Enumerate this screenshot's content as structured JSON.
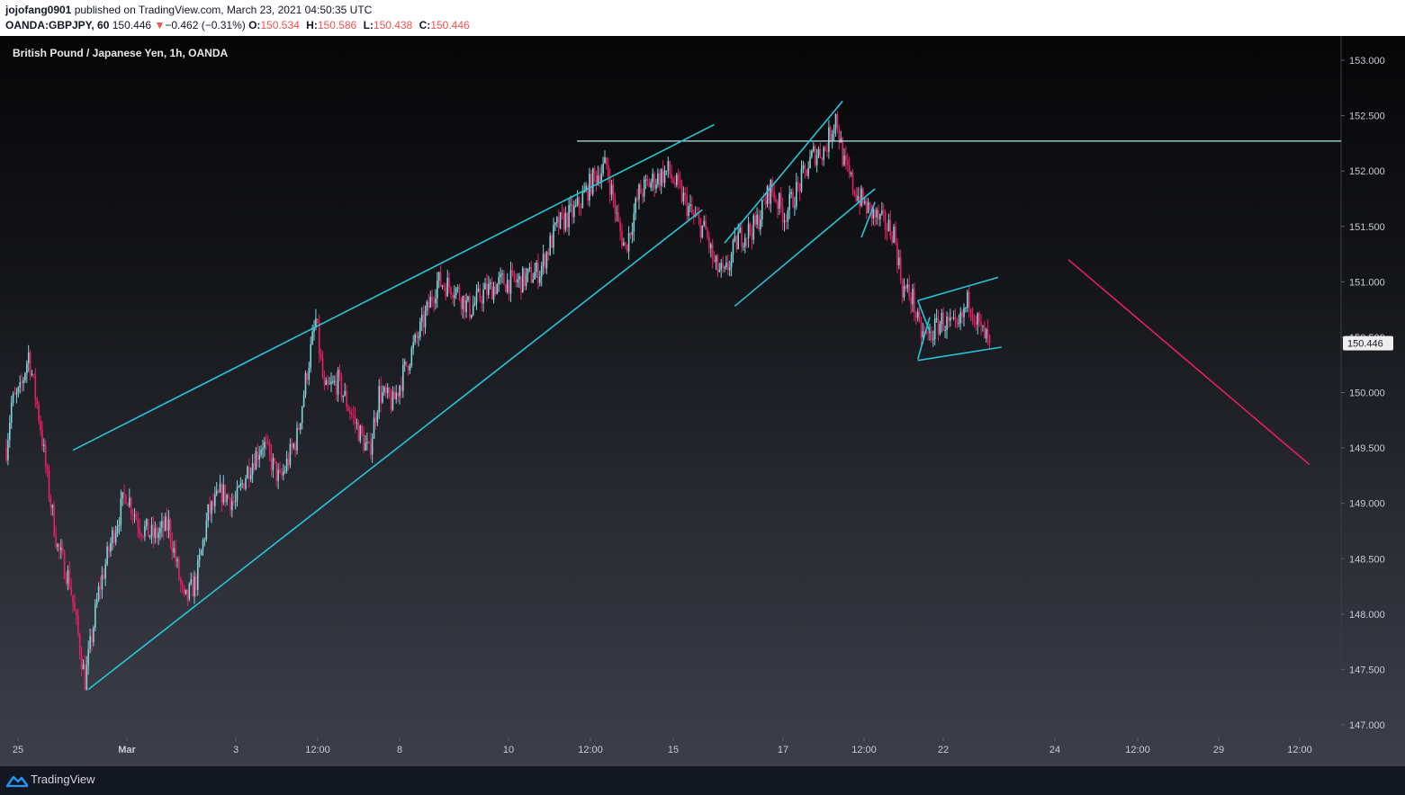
{
  "header": {
    "user": "jojofang0901",
    "published_text": " published on TradingView.com, March 23, 2021 04:50:35 UTC",
    "symbol": "OANDA:GBPJPY, 60",
    "price": "150.446",
    "change_arrow": "▼",
    "change": "−0.462 (−0.31%)",
    "o_label": "O:",
    "o_value": "150.534",
    "h_label": "H:",
    "h_value": "150.586",
    "l_label": "L:",
    "l_value": "150.438",
    "c_label": "C:",
    "c_value": "150.446"
  },
  "chart_title": "British Pound / Japanese Yen, 1h, OANDA",
  "footer": {
    "brand": "TradingView"
  },
  "colors": {
    "bull": "#81d4da",
    "bear": "#e91e63",
    "trendline": "#26c6da",
    "resistance": "#b2ebf2",
    "projection": "#e91e63",
    "axis_text": "#c8cbd4",
    "price_label_bg": "#eeeeee"
  },
  "chart_data": {
    "type": "candlestick",
    "interval": "1h",
    "ylim": [
      146.88,
      153.2
    ],
    "y_ticks": [
      "147.000",
      "147.500",
      "148.000",
      "148.500",
      "149.000",
      "149.500",
      "150.000",
      "150.500",
      "151.000",
      "151.500",
      "152.000",
      "152.500",
      "153.000"
    ],
    "x_ticks": [
      "25",
      "Mar",
      "3",
      "12:00",
      "8",
      "10",
      "12:00",
      "15",
      "17",
      "12:00",
      "22",
      "24",
      "12:00",
      "29",
      "12:00"
    ],
    "last_price_label": "150.446",
    "last_price": 150.446,
    "horizontal_level": 152.27,
    "anchors": [
      {
        "t": 0,
        "v": 149.5
      },
      {
        "t": 3,
        "v": 149.9
      },
      {
        "t": 8,
        "v": 150.0
      },
      {
        "t": 13,
        "v": 150.35
      },
      {
        "t": 20,
        "v": 149.7
      },
      {
        "t": 24,
        "v": 149.2
      },
      {
        "t": 30,
        "v": 148.6
      },
      {
        "t": 37,
        "v": 148.3
      },
      {
        "t": 46,
        "v": 147.4
      },
      {
        "t": 54,
        "v": 148.2
      },
      {
        "t": 62,
        "v": 148.7
      },
      {
        "t": 70,
        "v": 149.1
      },
      {
        "t": 78,
        "v": 148.8
      },
      {
        "t": 86,
        "v": 148.7
      },
      {
        "t": 95,
        "v": 148.8
      },
      {
        "t": 104,
        "v": 148.1
      },
      {
        "t": 111,
        "v": 148.3
      },
      {
        "t": 118,
        "v": 148.9
      },
      {
        "t": 126,
        "v": 149.1
      },
      {
        "t": 134,
        "v": 149.0
      },
      {
        "t": 141,
        "v": 149.3
      },
      {
        "t": 150,
        "v": 149.55
      },
      {
        "t": 160,
        "v": 149.2
      },
      {
        "t": 170,
        "v": 149.6
      },
      {
        "t": 176,
        "v": 150.2
      },
      {
        "t": 181,
        "v": 150.65
      },
      {
        "t": 186,
        "v": 150.0
      },
      {
        "t": 194,
        "v": 150.1
      },
      {
        "t": 202,
        "v": 149.8
      },
      {
        "t": 212,
        "v": 149.45
      },
      {
        "t": 218,
        "v": 150.0
      },
      {
        "t": 226,
        "v": 149.9
      },
      {
        "t": 234,
        "v": 150.25
      },
      {
        "t": 243,
        "v": 150.6
      },
      {
        "t": 252,
        "v": 151.0
      },
      {
        "t": 262,
        "v": 150.95
      },
      {
        "t": 271,
        "v": 150.75
      },
      {
        "t": 279,
        "v": 150.9
      },
      {
        "t": 290,
        "v": 151.0
      },
      {
        "t": 300,
        "v": 151.0
      },
      {
        "t": 312,
        "v": 151.1
      },
      {
        "t": 322,
        "v": 151.5
      },
      {
        "t": 333,
        "v": 151.65
      },
      {
        "t": 344,
        "v": 151.95
      },
      {
        "t": 351,
        "v": 152.05
      },
      {
        "t": 358,
        "v": 151.5
      },
      {
        "t": 362,
        "v": 151.3
      },
      {
        "t": 370,
        "v": 151.8
      },
      {
        "t": 377,
        "v": 151.9
      },
      {
        "t": 387,
        "v": 152.0
      },
      {
        "t": 396,
        "v": 151.75
      },
      {
        "t": 401,
        "v": 151.6
      },
      {
        "t": 409,
        "v": 151.45
      },
      {
        "t": 414,
        "v": 151.15
      },
      {
        "t": 420,
        "v": 151.05
      },
      {
        "t": 428,
        "v": 151.4
      },
      {
        "t": 438,
        "v": 151.5
      },
      {
        "t": 447,
        "v": 151.85
      },
      {
        "t": 455,
        "v": 151.6
      },
      {
        "t": 463,
        "v": 151.85
      },
      {
        "t": 472,
        "v": 152.15
      },
      {
        "t": 479,
        "v": 152.2
      },
      {
        "t": 485,
        "v": 152.5
      },
      {
        "t": 490,
        "v": 152.05
      },
      {
        "t": 497,
        "v": 151.8
      },
      {
        "t": 504,
        "v": 151.65
      },
      {
        "t": 511,
        "v": 151.55
      },
      {
        "t": 519,
        "v": 151.45
      },
      {
        "t": 524,
        "v": 150.95
      },
      {
        "t": 530,
        "v": 150.85
      },
      {
        "t": 534,
        "v": 150.55
      },
      {
        "t": 539,
        "v": 150.5
      },
      {
        "t": 547,
        "v": 150.65
      },
      {
        "t": 556,
        "v": 150.55
      },
      {
        "t": 563,
        "v": 150.85
      },
      {
        "t": 570,
        "v": 150.55
      },
      {
        "t": 575,
        "v": 150.446
      }
    ],
    "drawings": [
      {
        "type": "trendline",
        "from": {
          "t": 39,
          "v": 149.48
        },
        "to": {
          "t": 414,
          "v": 152.42
        }
      },
      {
        "t_note": "",
        "type": "trendline",
        "from": {
          "t": 48,
          "v": 147.32
        },
        "to": {
          "t": 407,
          "v": 151.65
        }
      },
      {
        "type": "trendline",
        "from": {
          "t": 426,
          "v": 150.78
        },
        "to": {
          "t": 508,
          "v": 151.84
        }
      },
      {
        "type": "trendline",
        "from": {
          "t": 420,
          "v": 151.35
        },
        "to": {
          "t": 489,
          "v": 152.63
        }
      },
      {
        "type": "trendline",
        "from": {
          "t": 500,
          "v": 151.4
        },
        "to": {
          "t": 508,
          "v": 151.72
        }
      },
      {
        "type": "trendline",
        "from": {
          "t": 533,
          "v": 150.83
        },
        "to": {
          "t": 580,
          "v": 151.04
        }
      },
      {
        "type": "trendline",
        "from": {
          "t": 533,
          "v": 150.29
        },
        "to": {
          "t": 582,
          "v": 150.41
        }
      },
      {
        "type": "trendline",
        "from": {
          "t": 533,
          "v": 150.83
        },
        "to": {
          "t": 540,
          "v": 150.55
        }
      },
      {
        "type": "trendline",
        "from": {
          "t": 533,
          "v": 150.3
        },
        "to": {
          "t": 540,
          "v": 150.68
        }
      },
      {
        "type": "projection",
        "from": {
          "t": 621,
          "v": 151.2
        },
        "to": {
          "t": 762,
          "v": 149.35
        }
      }
    ]
  }
}
